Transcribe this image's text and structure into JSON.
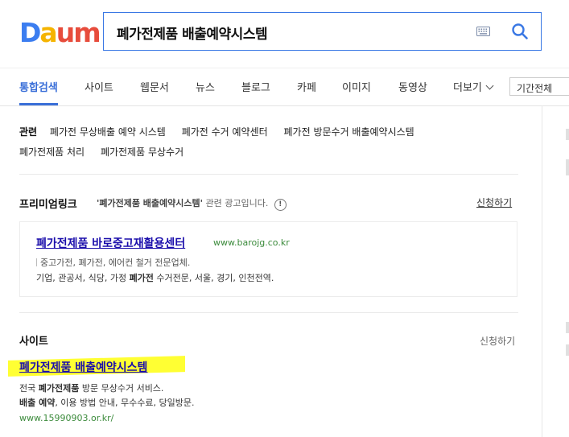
{
  "logo": {
    "letters": [
      "D",
      "a",
      "u",
      "m"
    ],
    "colors": [
      "#3b7df0",
      "#f5b400",
      "#e74c3c",
      "#e74c3c"
    ]
  },
  "search": {
    "query": "폐가전제품 배출예약시스템",
    "keyboard_icon": "keyboard-icon",
    "button_icon": "search-icon",
    "accent": "#3a78e4"
  },
  "tabs": [
    {
      "label": "통합검색",
      "active": true
    },
    {
      "label": "사이트"
    },
    {
      "label": "웹문서"
    },
    {
      "label": "뉴스"
    },
    {
      "label": "블로그"
    },
    {
      "label": "카페"
    },
    {
      "label": "이미지"
    },
    {
      "label": "동영상"
    },
    {
      "label": "더보기"
    }
  ],
  "period": "기간전체",
  "related": {
    "label": "관련",
    "items": [
      "폐가전 무상배출 예약 시스템",
      "폐가전 수거 예약센터",
      "폐가전 방문수거 배출예약시스템",
      "폐가전제품 처리",
      "폐가전제품 무상수거"
    ]
  },
  "premium": {
    "title": "프리미엄링크",
    "query_quote": "'폐가전제품 배출예약시스템'",
    "desc_suffix": "관련 광고입니다.",
    "info": "!",
    "apply": "신청하기",
    "ad": {
      "title": "폐가전제품 바로중고재활용센터",
      "url": "www.barojg.co.kr",
      "line1": "중고가전, 폐가전, 에어컨 철거 전문업체.",
      "line2_pre": "기업, 관공서, 식당, 가정 ",
      "line2_bold": "폐가전",
      "line2_post": " 수거전문, 서울, 경기, 인천전역."
    }
  },
  "site": {
    "title": "사이트",
    "apply": "신청하기",
    "result": {
      "title": "폐가전제품 배출예약시스템",
      "line1_pre": "전국 ",
      "line1_bold": "폐가전제품",
      "line1_post": " 방문 무상수거 서비스.",
      "line2_bold": "배출 예약",
      "line2_post": ", 이용 방법 안내, 무수수료, 당일방문.",
      "url": "www.15990903.or.kr/"
    }
  }
}
